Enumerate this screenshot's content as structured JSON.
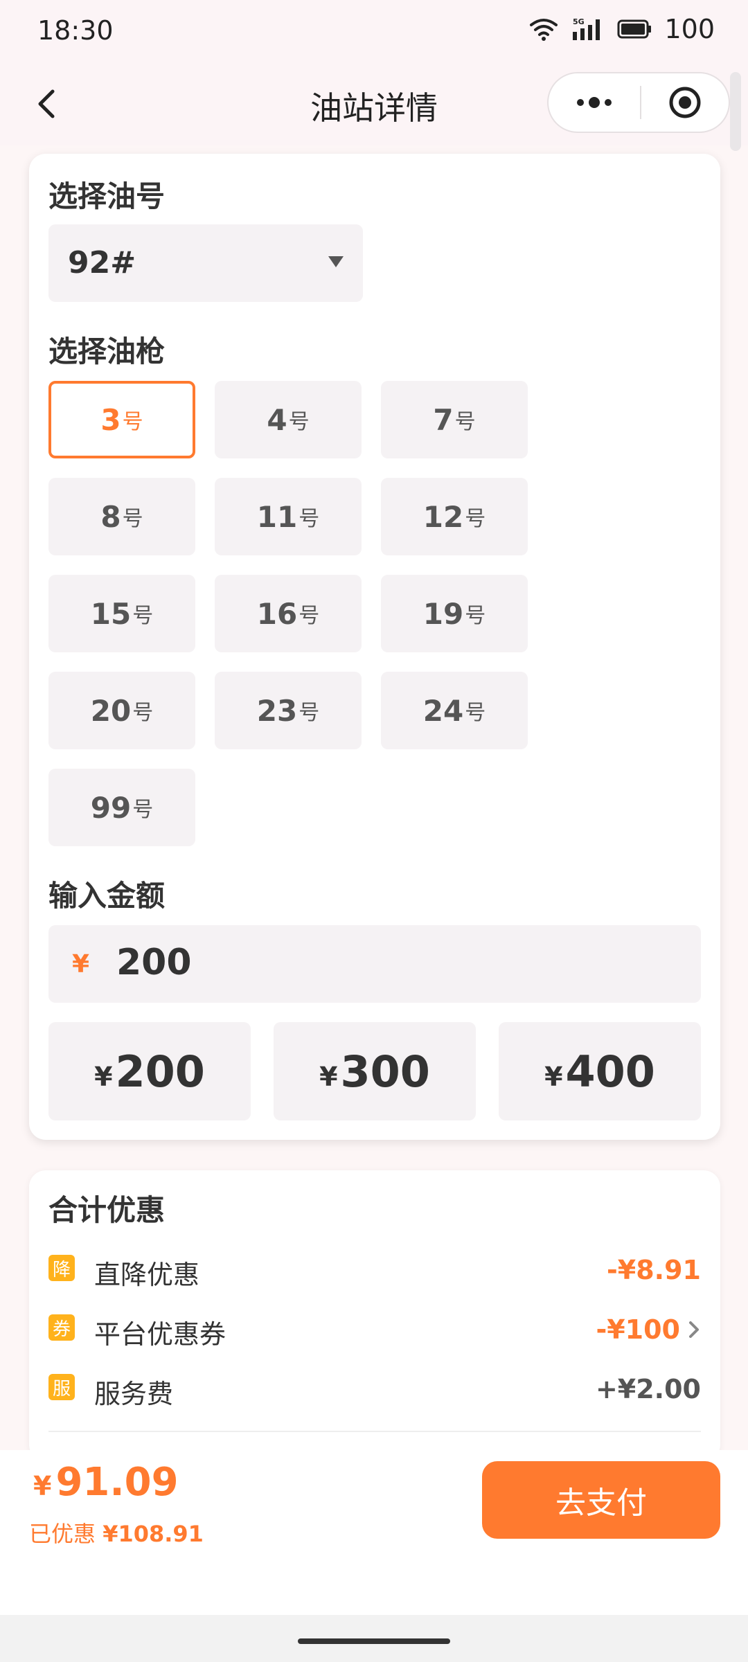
{
  "status_bar": {
    "time": "18:30",
    "network": "5G",
    "battery": "100"
  },
  "nav": {
    "title": "油站详情"
  },
  "fuel": {
    "section_title": "选择油号",
    "selected": "92#"
  },
  "guns": {
    "section_title": "选择油枪",
    "suffix": "号",
    "items": [
      {
        "num": "3",
        "active": true
      },
      {
        "num": "4"
      },
      {
        "num": "7"
      },
      {
        "num": "8"
      },
      {
        "num": "11"
      },
      {
        "num": "12"
      },
      {
        "num": "15"
      },
      {
        "num": "16"
      },
      {
        "num": "19"
      },
      {
        "num": "20"
      },
      {
        "num": "23"
      },
      {
        "num": "24"
      },
      {
        "num": "99"
      }
    ]
  },
  "amount": {
    "section_title": "输入金额",
    "currency": "¥",
    "value": "200",
    "presets": [
      {
        "yen": "¥",
        "amount": "200"
      },
      {
        "yen": "¥",
        "amount": "300"
      },
      {
        "yen": "¥",
        "amount": "400"
      }
    ]
  },
  "discounts": {
    "section_title": "合计优惠",
    "rows": [
      {
        "badge": "降",
        "label": "直降优惠",
        "value": "-¥8.91"
      },
      {
        "badge": "券",
        "label": "平台优惠券",
        "value": "-¥100"
      },
      {
        "badge": "服",
        "label": "服务费",
        "value": "+¥2.00"
      }
    ]
  },
  "checkout": {
    "currency": "¥",
    "total": "91.09",
    "saved_label": "已优惠",
    "saved_amount": "¥108.91",
    "pay_label": "去支付"
  },
  "colors": {
    "accent": "#ff7a2f",
    "badge": "#ffb21c",
    "chip_bg": "#f5f2f4"
  }
}
